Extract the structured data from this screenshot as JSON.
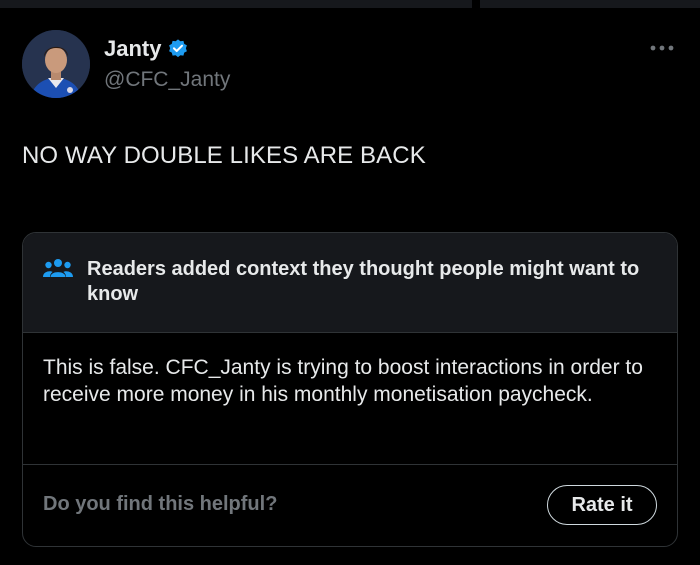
{
  "tweet": {
    "display_name": "Janty",
    "handle": "@CFC_Janty",
    "verified": true,
    "text": "NO WAY DOUBLE LIKES ARE BACK",
    "more_icon": "more-horizontal-icon"
  },
  "community_note": {
    "icon": "people-icon",
    "title": "Readers added context they thought people might want to know",
    "text": "This is false. CFC_Janty is trying to boost interactions in order to receive more money in his monthly monetisation paycheck.",
    "helpful_question": "Do you find this helpful?",
    "rate_button_label": "Rate it"
  },
  "colors": {
    "background": "#000000",
    "text_primary": "#e7e9ea",
    "text_secondary": "#71767b",
    "verified_blue": "#1d9bf0",
    "note_header_bg": "#16181c",
    "border": "#2f3336"
  }
}
